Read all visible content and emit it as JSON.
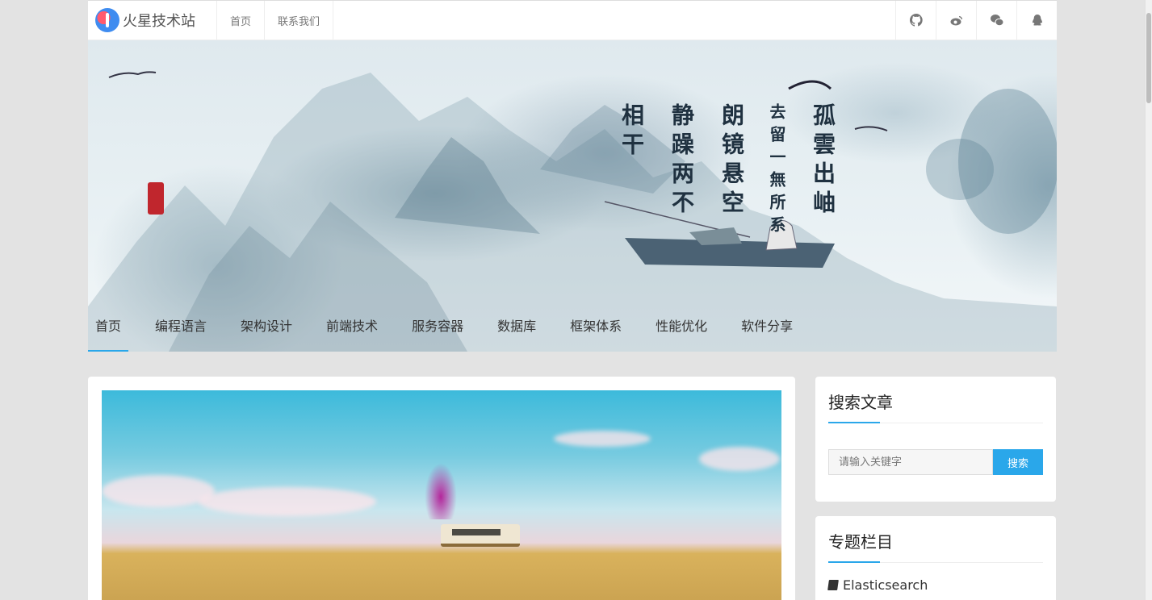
{
  "header": {
    "brand_name": "火星技术站",
    "links": [
      "首页",
      "联系我们"
    ],
    "social_icons": [
      "github-icon",
      "weibo-icon",
      "wechat-icon",
      "qq-icon"
    ]
  },
  "banner": {
    "calligraphy": [
      "孤雲出岫",
      "去留一無所系",
      "朗镜悬空",
      "静躁两不",
      "相干"
    ]
  },
  "nav": {
    "items": [
      "首页",
      "编程语言",
      "架构设计",
      "前端技术",
      "服务容器",
      "数据库",
      "框架体系",
      "性能优化",
      "软件分享"
    ],
    "active_index": 0
  },
  "sidebar": {
    "search": {
      "title": "搜索文章",
      "placeholder": "请输入关键字",
      "button": "搜索"
    },
    "topics": {
      "title": "专题栏目",
      "items": [
        "Elasticsearch"
      ]
    }
  },
  "colors": {
    "accent": "#2aa7ea",
    "page_bg": "#e3e3e3"
  }
}
